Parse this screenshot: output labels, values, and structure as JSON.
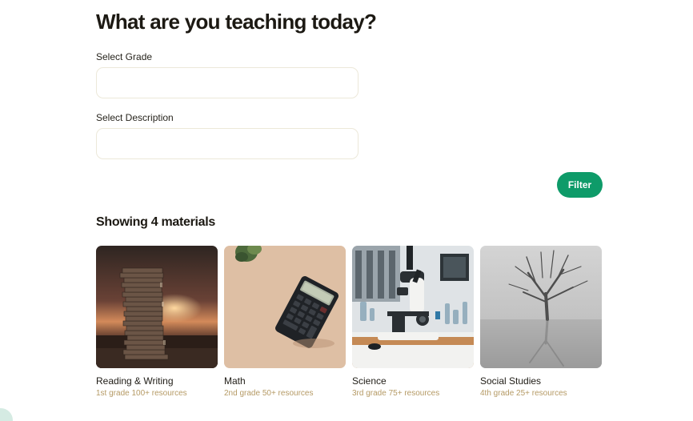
{
  "header": {
    "title": "What are you teaching today?"
  },
  "filters": {
    "grade_label": "Select Grade",
    "grade_value": "",
    "description_label": "Select Description",
    "description_value": "",
    "filter_button": "Filter"
  },
  "results": {
    "summary": "Showing 4 materials",
    "cards": [
      {
        "title": "Reading & Writing",
        "meta": "1st grade 100+ resources",
        "image": "stack-of-books-at-sunset"
      },
      {
        "title": "Math",
        "meta": "2nd grade 50+ resources",
        "image": "calculator-on-desk"
      },
      {
        "title": "Science",
        "meta": "3rd grade 75+ resources",
        "image": "microscope-in-lab"
      },
      {
        "title": "Social Studies",
        "meta": "4th grade 25+ resources",
        "image": "bare-tree-in-fog"
      }
    ]
  },
  "colors": {
    "accent": "#0e9b69",
    "meta_text": "#b59a65",
    "field_border": "#ece8d9",
    "title_text": "#1c1913"
  }
}
